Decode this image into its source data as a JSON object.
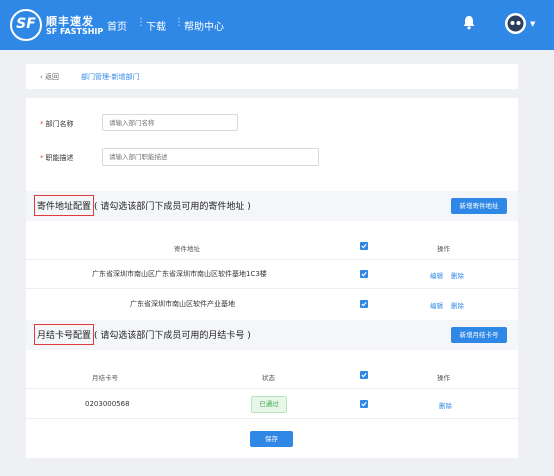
{
  "header": {
    "logo_mark": "SF",
    "logo_cn": "顺丰速发",
    "logo_en": "SF FASTSHIP",
    "nav": [
      "首页",
      "下载",
      "帮助中心"
    ],
    "nav_separator": "⋮"
  },
  "breadcrumb": {
    "back": "返回",
    "path": "部门管理-新增部门"
  },
  "form": {
    "dept_name_label": "部门名称",
    "dept_name_placeholder": "请输入部门名称",
    "dept_desc_label": "职能描述",
    "dept_desc_placeholder": "请输入部门职能描述"
  },
  "address_section": {
    "title_boxed": "寄件地址配置",
    "title_rest": "( 请勾选该部门下成员可用的寄件地址 )",
    "add_button": "新增寄件地址",
    "columns": [
      "寄件地址",
      "操作"
    ],
    "rows": [
      {
        "address": "广东省深圳市南山区广东省深圳市南山区软件基地1C3楼",
        "edit": "编辑",
        "delete": "删除"
      },
      {
        "address": "广东省深圳市南山区软件产业基地",
        "edit": "编辑",
        "delete": "删除"
      }
    ]
  },
  "card_section": {
    "title_boxed": "月结卡号配置",
    "title_rest": "( 请勾选该部门下成员可用的月结卡号 )",
    "add_button": "新增月结卡号",
    "columns": [
      "月结卡号",
      "状态",
      "操作"
    ],
    "rows": [
      {
        "card": "0203000568",
        "status": "已通过",
        "delete": "删除"
      }
    ]
  },
  "save_button": "保存",
  "colors": {
    "primary": "#2f88e6",
    "required": "#e84c3d",
    "highlight_box": "#e03a3a",
    "status_ok": "#3aa84a"
  }
}
